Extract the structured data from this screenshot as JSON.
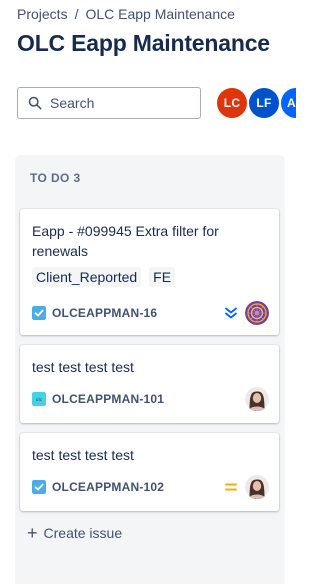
{
  "breadcrumb": {
    "projects": "Projects",
    "separator": "/",
    "project": "OLC Eapp Maintenance"
  },
  "page_title": "OLC Eapp Maintenance",
  "search": {
    "placeholder": "Search",
    "value": ""
  },
  "avatars": [
    {
      "initials": "LC",
      "color": "#de350b"
    },
    {
      "initials": "LF",
      "color": "#0052cc"
    },
    {
      "initials": "AC",
      "color": "#0065ff"
    }
  ],
  "column": {
    "title": "TO DO 3",
    "cards": [
      {
        "title": "Eapp - #099945 Extra filter for renewals",
        "labels": [
          "Client_Reported",
          "FE"
        ],
        "key": "OLCEAPPMAN-16",
        "type_icon": "checkbox-task-icon",
        "priority": "lowest-priority-icon"
      },
      {
        "title": "test test test test",
        "labels": [],
        "key": "OLCEAPPMAN-101",
        "type_icon": "olc-project-icon",
        "priority": ""
      },
      {
        "title": "test test test test",
        "labels": [],
        "key": "OLCEAPPMAN-102",
        "type_icon": "checkbox-task-icon",
        "priority": "medium-priority-icon"
      }
    ],
    "create_label": "Create issue"
  },
  "colors": {
    "task_blue": "#4bade8",
    "lowest_priority": "#0065ff",
    "medium_priority": "#ffab00",
    "olc_badge": "#45d1e1"
  }
}
